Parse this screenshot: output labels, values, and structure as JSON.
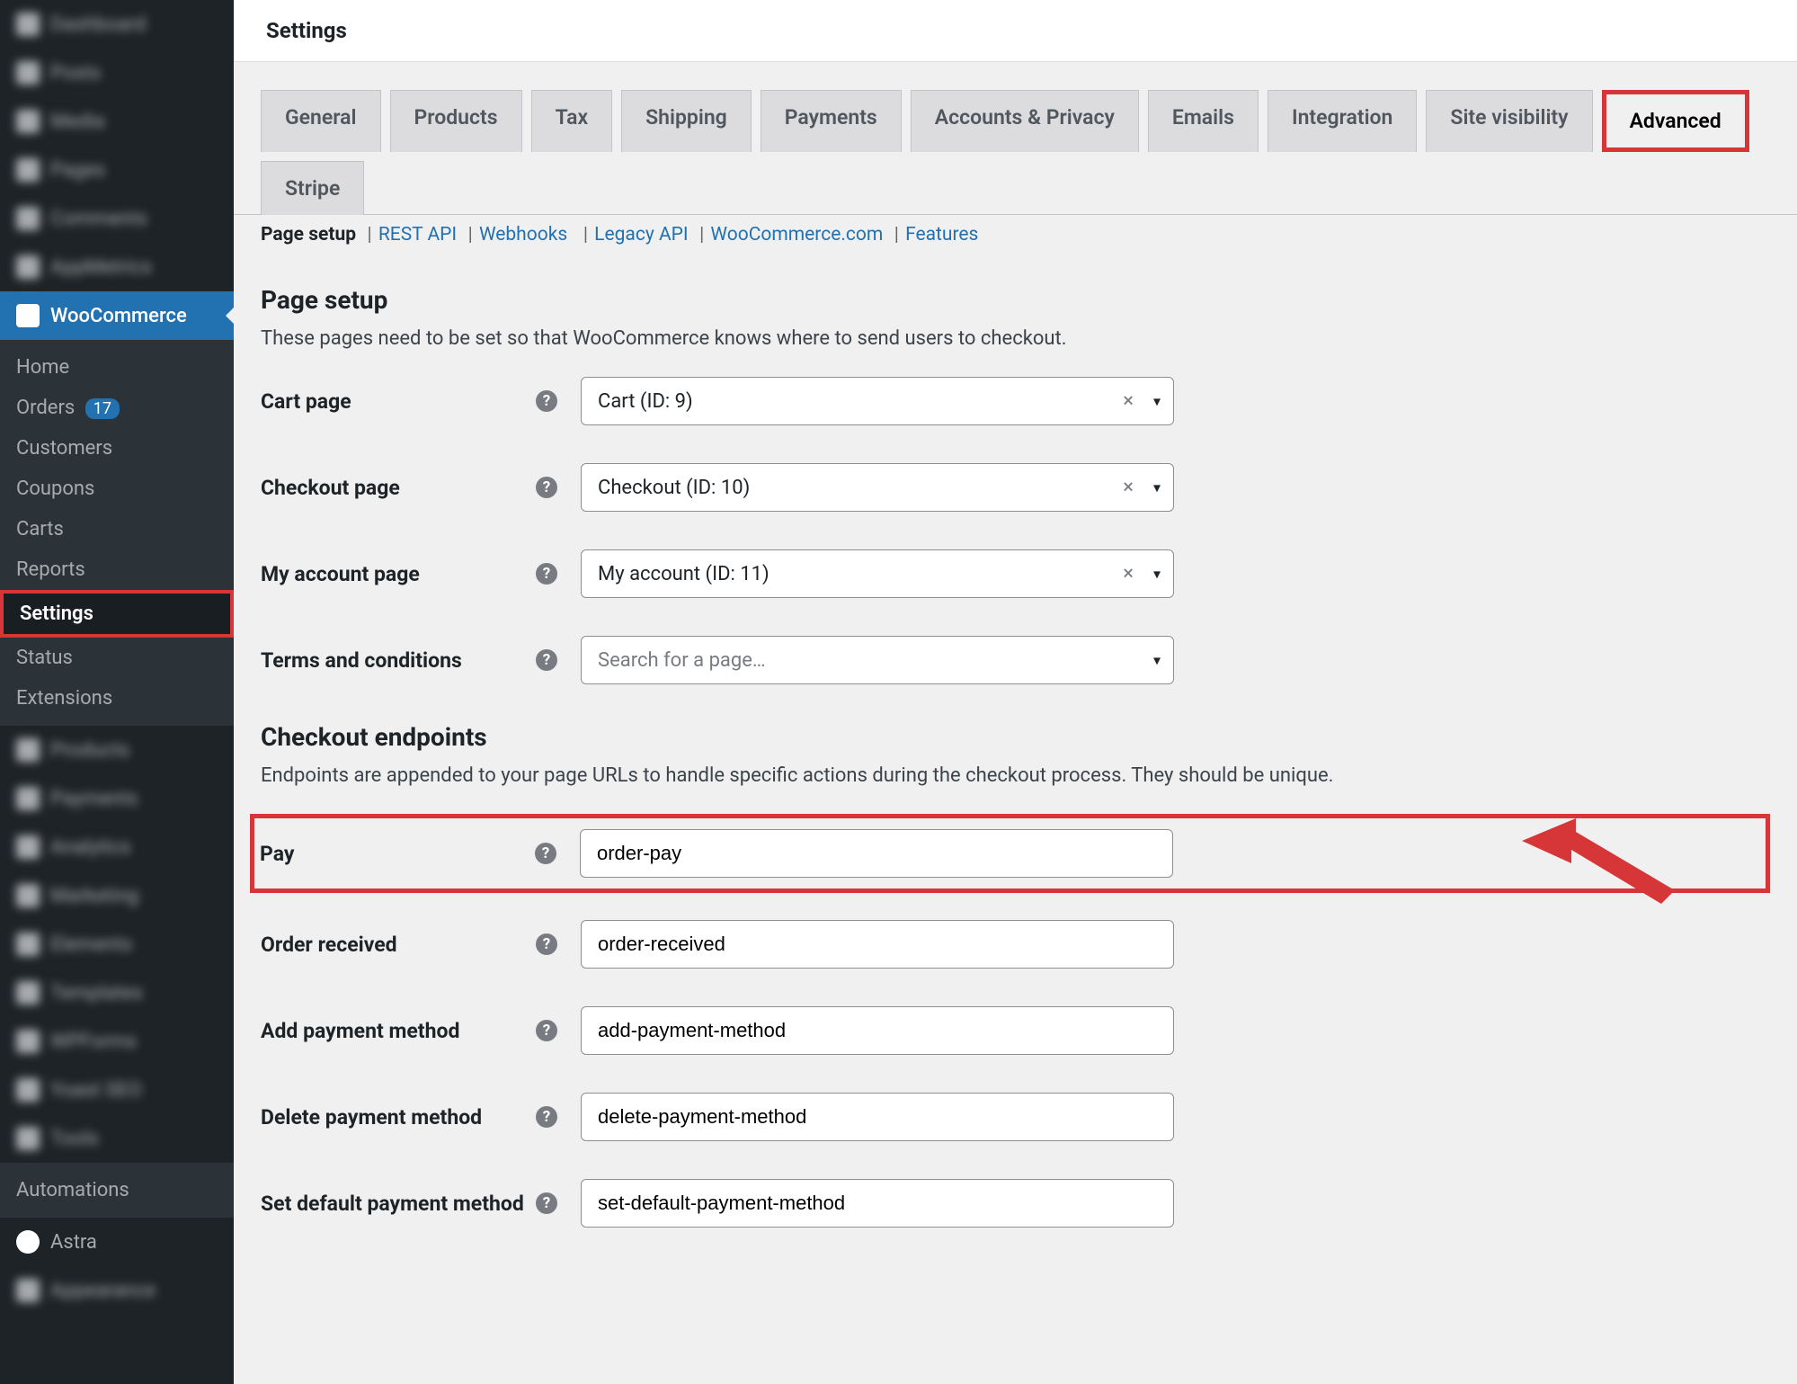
{
  "header": {
    "title": "Settings"
  },
  "sidebar_blur_top": [
    "Dashboard",
    "Posts",
    "Media",
    "Pages",
    "Comments",
    "AppMetrics"
  ],
  "sidebar_wc": {
    "label": "WooCommerce"
  },
  "sidebar_sub": {
    "home": "Home",
    "orders": "Orders",
    "orders_badge": "17",
    "customers": "Customers",
    "coupons": "Coupons",
    "carts": "Carts",
    "reports": "Reports",
    "settings": "Settings",
    "status": "Status",
    "extensions": "Extensions"
  },
  "sidebar_blur_mid": [
    "Products",
    "Payments",
    "Analytics",
    "Marketing",
    "Elements",
    "Templates",
    "WPForms",
    "Yoast SEO",
    "Tools"
  ],
  "sidebar_automations": "Automations",
  "sidebar_astra": "Astra",
  "sidebar_last_blur": "Appearance",
  "tabs": {
    "general": "General",
    "products": "Products",
    "tax": "Tax",
    "shipping": "Shipping",
    "payments": "Payments",
    "accounts": "Accounts & Privacy",
    "emails": "Emails",
    "integration": "Integration",
    "site_visibility": "Site visibility",
    "advanced": "Advanced",
    "stripe": "Stripe"
  },
  "subnav": {
    "page_setup": "Page setup",
    "rest_api": "REST API",
    "webhooks": "Webhooks",
    "legacy_api": "Legacy API",
    "wc_com": "WooCommerce.com",
    "features": "Features"
  },
  "sections": {
    "page_setup_title": "Page setup",
    "page_setup_desc": "These pages need to be set so that WooCommerce knows where to send users to checkout.",
    "checkout_endpoints_title": "Checkout endpoints",
    "checkout_endpoints_desc": "Endpoints are appended to your page URLs to handle specific actions during the checkout process. They should be unique."
  },
  "fields": {
    "cart_page": {
      "label": "Cart page",
      "value": "Cart (ID: 9)"
    },
    "checkout_page": {
      "label": "Checkout page",
      "value": "Checkout (ID: 10)"
    },
    "my_account": {
      "label": "My account page",
      "value": "My account (ID: 11)"
    },
    "terms": {
      "label": "Terms and conditions",
      "placeholder": "Search for a page…"
    },
    "pay": {
      "label": "Pay",
      "value": "order-pay"
    },
    "order_received": {
      "label": "Order received",
      "value": "order-received"
    },
    "add_payment": {
      "label": "Add payment method",
      "value": "add-payment-method"
    },
    "delete_payment": {
      "label": "Delete payment method",
      "value": "delete-payment-method"
    },
    "set_default": {
      "label": "Set default payment method",
      "value": "set-default-payment-method"
    }
  }
}
